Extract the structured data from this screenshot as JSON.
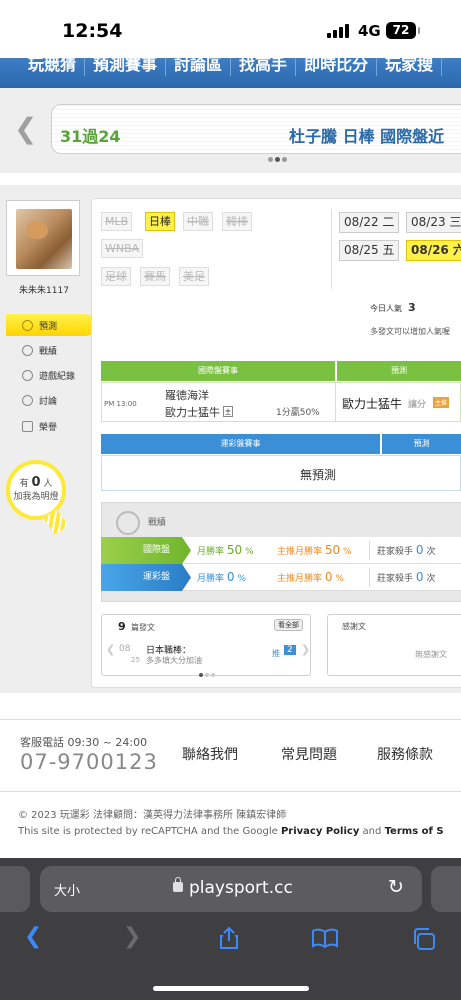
{
  "status": {
    "time": "12:54",
    "network": "4G",
    "battery": "72"
  },
  "topnav": [
    "玩競猜",
    "預測賽事",
    "討論區",
    "找高手",
    "即時比分",
    "玩家搜"
  ],
  "marquee": {
    "left": "31過24",
    "right": "杜子騰 日棒 國際盤近"
  },
  "profile": {
    "username": "朱朱朱1117",
    "menu": [
      "預測",
      "戰績",
      "遊戲紀錄",
      "討論",
      "榮譽"
    ],
    "fans_prefix": "有",
    "fans_count": "0",
    "fans_unit": "人",
    "fans_cta": "加我為明燈"
  },
  "sports_row1": [
    "MLB",
    "日棒",
    "中職",
    "韓棒"
  ],
  "sports_row2": [
    "WNBA"
  ],
  "sports_row3": [
    "足球",
    "賽馬",
    "美足"
  ],
  "active_sport": "日棒",
  "dates": [
    "08/22 二",
    "08/23 三",
    "08/25 五",
    "08/26 六"
  ],
  "popularity": {
    "label": "今日人氣",
    "value": "3",
    "tip": "多發文可以增加人氣喔"
  },
  "intl_table": {
    "header_game": "國際盤賽事",
    "header_pred": "預測",
    "time": "PM 13:00",
    "team1": "羅德海洋",
    "team2": "歐力士猛牛",
    "team2_tag": "主",
    "handicap": "1分贏50%",
    "pick": "歐力士猛牛",
    "pick_type": "讓分",
    "pick_badge": "主推"
  },
  "lottery_table": {
    "header_game": "運彩盤賽事",
    "header_pred": "預測",
    "empty": "無預測"
  },
  "stats": {
    "title": "戰績",
    "rows": [
      {
        "label": "國際盤",
        "winrate_label": "月勝率",
        "winrate": "50",
        "main_label": "主推月勝率",
        "main": "50",
        "killer_label": "莊家殺手",
        "killer": "0",
        "unit_pct": "%",
        "unit_times": "次"
      },
      {
        "label": "運彩盤",
        "winrate_label": "月勝率",
        "winrate": "0",
        "main_label": "主推月勝率",
        "main": "0",
        "killer_label": "莊家殺手",
        "killer": "0",
        "unit_pct": "%",
        "unit_times": "次"
      }
    ]
  },
  "posts": {
    "count": "9",
    "label": "篇發文",
    "view_all": "看全部",
    "date_month": "08",
    "date_day": "25",
    "title": "日本職棒：",
    "snippet": "多多填大分加油",
    "push_label": "推",
    "push_count": "2"
  },
  "thanks": {
    "title": "感謝文",
    "empty": "無感謝文"
  },
  "footer": {
    "service_label": "客服電話 09:30 ~ 24:00",
    "phone": "07-9700123",
    "links": [
      "聯絡我們",
      "常見問題",
      "服務條款"
    ],
    "copyright": "© 2023 玩運彩 法律顧問：漢英得力法律事務所 陳鎮宏律師",
    "recaptcha_text": "This site is protected by reCAPTCHA and the Google",
    "privacy": "Privacy Policy",
    "and": "and",
    "terms": "Terms of S"
  },
  "browser": {
    "text_size": "大小",
    "url": "playsport.cc"
  },
  "colors": {
    "nav_blue": "#2b67ad",
    "green": "#7ac142",
    "blue": "#3a8fd6",
    "yellow": "#ffd400"
  }
}
